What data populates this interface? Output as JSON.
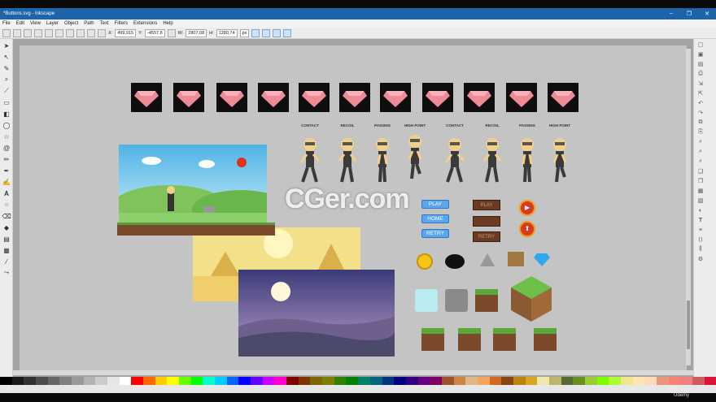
{
  "window": {
    "title": "*Buttons.svg - Inkscape",
    "controls": [
      "–",
      "❐",
      "✕"
    ]
  },
  "menu": [
    "File",
    "Edit",
    "View",
    "Layer",
    "Object",
    "Path",
    "Text",
    "Filters",
    "Extensions",
    "Help"
  ],
  "toolbar": {
    "x_label": "X:",
    "x_value": "499,915",
    "y_label": "Y:",
    "y_value": "-4557,8",
    "w_label": "W:",
    "w_value": "2807,08",
    "h_label": "H:",
    "h_value": "1280,74",
    "unit": "px"
  },
  "canvas": {
    "labels": [
      "CONTACT",
      "RECOIL",
      "PASSING",
      "HIGH POINT",
      "CONTACT",
      "RECOIL",
      "PASSING",
      "HIGH POINT"
    ],
    "buttons": {
      "play": "PLAY",
      "home": "HOME",
      "retry": "RETRY"
    },
    "wood": {
      "play": "PLAY",
      "retry": "RETRY"
    }
  },
  "watermark": "CGer.com",
  "udemy": "Udemy",
  "colors": {
    "titlebar": "#1e64a8",
    "canvas": "#a3a3a3",
    "gem": "#f08a95"
  },
  "palette": [
    "#000000",
    "#1a1a1a",
    "#333",
    "#4d4d4d",
    "#666",
    "#808080",
    "#999",
    "#b3b3b3",
    "#ccc",
    "#e6e6e6",
    "#fff",
    "#ff0000",
    "#ff6600",
    "#ffcc00",
    "#ffff00",
    "#66ff00",
    "#00ff00",
    "#00ffcc",
    "#00ccff",
    "#0066ff",
    "#0000ff",
    "#6600ff",
    "#cc00ff",
    "#ff00cc",
    "#800000",
    "#803300",
    "#806600",
    "#808000",
    "#338000",
    "#008000",
    "#008066",
    "#006680",
    "#003380",
    "#000080",
    "#330080",
    "#660080",
    "#800066",
    "#a0522d",
    "#cd853f",
    "#deb887",
    "#f4a460",
    "#d2691e",
    "#8b4513",
    "#b8860b",
    "#daa520",
    "#eee8aa",
    "#bdb76b",
    "#556b2f",
    "#6b8e23",
    "#9acd32",
    "#7cfc00",
    "#adff2f",
    "#f0e68c",
    "#ffe4b5",
    "#ffdab9",
    "#e9967a",
    "#fa8072",
    "#f08080",
    "#cd5c5c",
    "#dc143c"
  ]
}
